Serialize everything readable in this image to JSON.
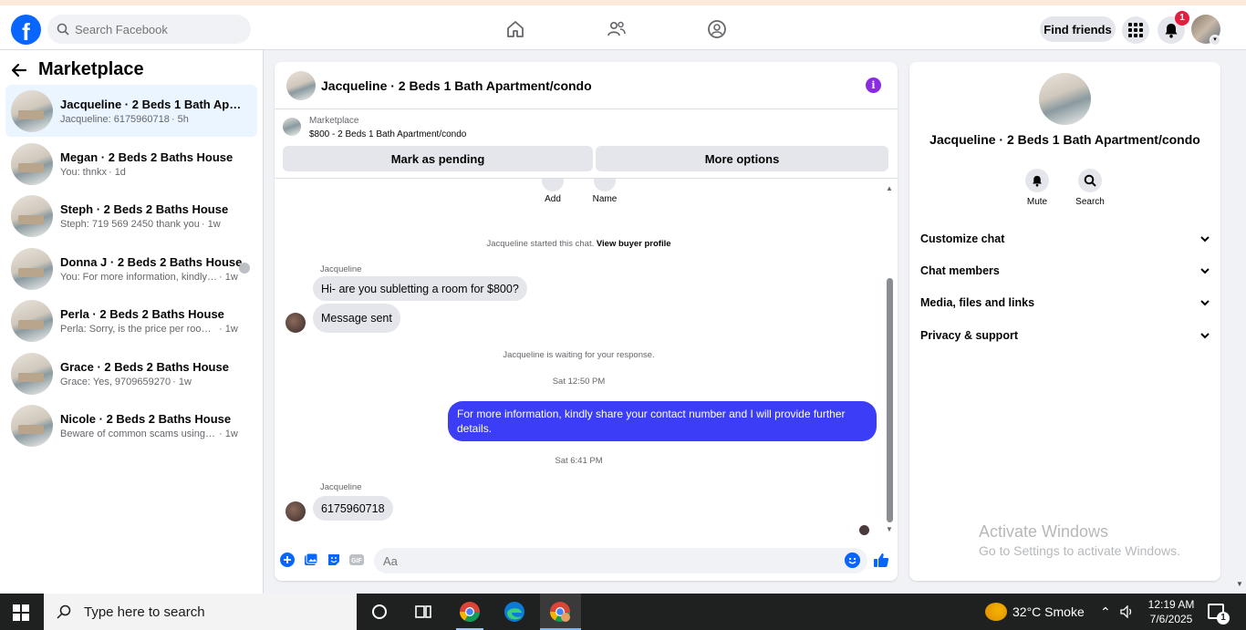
{
  "header": {
    "search_placeholder": "Search Facebook",
    "find_friends_label": "Find friends",
    "notification_count": "1",
    "logo_letter": "f"
  },
  "sidebar": {
    "title": "Marketplace",
    "conversations": [
      {
        "name": "Jacqueline · 2 Beds 1 Bath Apartm...",
        "preview": "Jacqueline: 6175960718",
        "time": "· 5h"
      },
      {
        "name": "Megan · 2 Beds 2 Baths House",
        "preview": "You: thnkx",
        "time": "· 1d"
      },
      {
        "name": "Steph · 2 Beds 2 Baths House",
        "preview": "Steph: 719 569 2450 thank you",
        "time": "· 1w"
      },
      {
        "name": "Donna J · 2 Beds 2 Baths House",
        "preview": "You: For more information, kindly s...",
        "time": "· 1w"
      },
      {
        "name": "Perla · 2 Beds 2 Baths House",
        "preview": "Perla: Sorry, is the price per room or f...",
        "time": "· 1w"
      },
      {
        "name": "Grace · 2 Beds 2 Baths House",
        "preview": "Grace: Yes, 9709659270",
        "time": "· 1w"
      },
      {
        "name": "Nicole · 2 Beds 2 Baths House",
        "preview": "Beware of common scams using pay...",
        "time": "· 1w"
      }
    ]
  },
  "chat": {
    "title": "Jacqueline · 2 Beds 1 Bath Apartment/condo",
    "listing_label": "Marketplace",
    "listing_price": "$800 - 2 Beds 1 Bath Apartment/condo",
    "mark_pending_label": "Mark as pending",
    "more_options_label": "More options",
    "add_label": "Add",
    "name_label": "Name",
    "started_text": "Jacqueline started this chat.",
    "view_buyer_profile": "View buyer profile",
    "sender1": "Jacqueline",
    "msg1": "Hi- are you subletting a room for $800?",
    "msg2": "Message sent",
    "waiting_text": "Jacqueline is waiting for your response.",
    "time1": "Sat 12:50 PM",
    "msg3": "For more information, kindly share your contact number and I will provide further details.",
    "time2": "Sat 6:41 PM",
    "sender2": "Jacqueline",
    "msg4": "6175960718",
    "composer_placeholder": "Aa",
    "gif_label": "GIF"
  },
  "rpanel": {
    "title": "Jacqueline · 2 Beds 1 Bath Apartment/condo",
    "mute_label": "Mute",
    "search_label": "Search",
    "sections": [
      "Customize chat",
      "Chat members",
      "Media, files and links",
      "Privacy & support"
    ],
    "watermark_line1": "Activate Windows",
    "watermark_line2": "Go to Settings to activate Windows."
  },
  "taskbar": {
    "search_placeholder": "Type here to search",
    "weather": "32°C  Smoke",
    "time": "12:19 AM",
    "date": "7/6/2025",
    "notif_count": "1"
  },
  "colors": {
    "fb_blue": "#0866ff",
    "outgoing_bubble": "#3b3ef6",
    "active_conv": "#ebf5ff",
    "info_purple": "#8a2be2",
    "badge_red": "#e41e3f"
  }
}
